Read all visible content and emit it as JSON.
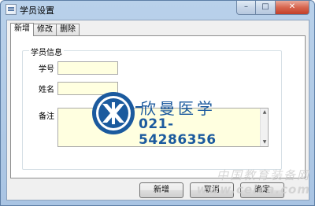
{
  "window": {
    "title": "学员设置",
    "minimize_glyph": "–",
    "maximize_glyph": "□",
    "close_glyph": "✕"
  },
  "tabs": [
    {
      "label": "新增",
      "active": true
    },
    {
      "label": "修改",
      "active": false
    },
    {
      "label": "删除",
      "active": false
    }
  ],
  "form": {
    "group_title": "学员信息",
    "fields": {
      "student_id": {
        "label": "学号",
        "value": ""
      },
      "name": {
        "label": "姓名",
        "value": ""
      },
      "notes": {
        "label": "备注",
        "value": ""
      }
    },
    "scroll_up": "▲",
    "scroll_down": "▼"
  },
  "buttons": {
    "add": "新增",
    "cancel": "取消",
    "confirm": "确定"
  },
  "watermark": {
    "name": "欣曼医学",
    "phone": "021-54286356",
    "brand_color": "#1b5a9e"
  },
  "site_watermark": {
    "line1": "中国教育装备网",
    "line2": "www.ceiea.com"
  }
}
